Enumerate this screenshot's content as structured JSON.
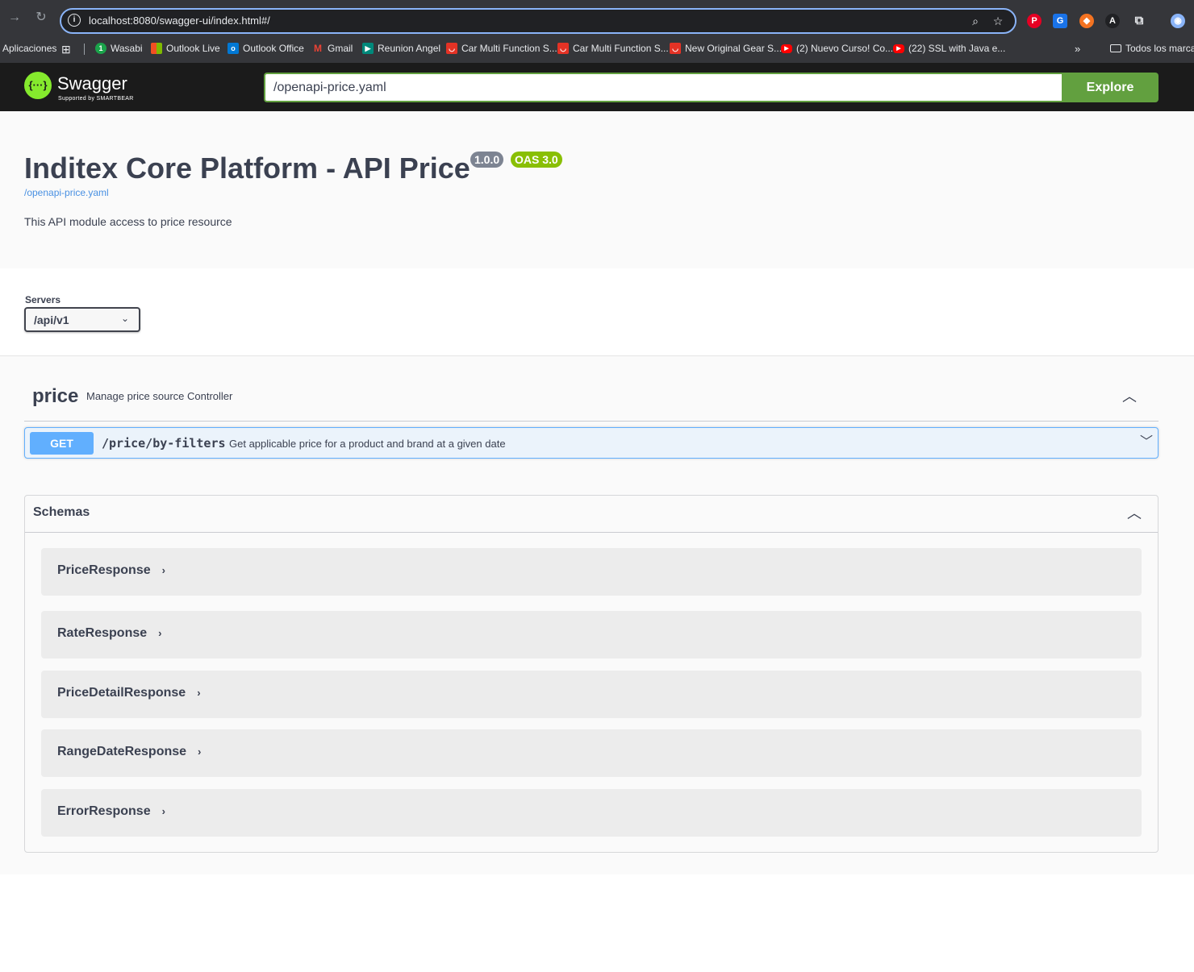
{
  "browser": {
    "url": "localhost:8080/swagger-ui/index.html#/",
    "bookmarks": [
      {
        "label": "Aplicaciones",
        "icon": "apps-icon"
      },
      {
        "label": "Wasabi",
        "icon": "wasabi-icon",
        "color": "#1aa34a"
      },
      {
        "label": "Outlook Live",
        "icon": "microsoft-icon",
        "color": "#f25022"
      },
      {
        "label": "Outlook Office",
        "icon": "outlook-icon",
        "color": "#0078d4"
      },
      {
        "label": "Gmail",
        "icon": "gmail-icon",
        "color": "#ea4335"
      },
      {
        "label": "Reunion Angel",
        "icon": "meet-icon",
        "color": "#00897b"
      },
      {
        "label": "Car Multi Function S...",
        "icon": "aliexpress-icon",
        "color": "#e43225"
      },
      {
        "label": "Car Multi Function S...",
        "icon": "aliexpress-icon",
        "color": "#e43225"
      },
      {
        "label": "New Original Gear S...",
        "icon": "aliexpress-icon",
        "color": "#e43225"
      },
      {
        "label": "(2) Nuevo Curso! Co...",
        "icon": "youtube-icon",
        "color": "#ff0000"
      },
      {
        "label": "(22) SSL with Java e...",
        "icon": "youtube-icon",
        "color": "#ff0000"
      }
    ],
    "all_bookmarks_label": "Todos los marcad"
  },
  "topbar": {
    "logo_text": "Swagger",
    "logo_sub": "Supported by SMARTBEAR",
    "url_value": "/openapi-price.yaml",
    "explore_label": "Explore"
  },
  "info": {
    "title": "Inditex Core Platform - API Price",
    "version": "1.0.0",
    "oas": "OAS 3.0",
    "spec_link": "/openapi-price.yaml",
    "description": "This API module access to price resource"
  },
  "servers": {
    "label": "Servers",
    "selected": "/api/v1"
  },
  "tag": {
    "name": "price",
    "description": "Manage price source Controller",
    "operations": [
      {
        "method": "GET",
        "path": "/price/by-filters",
        "summary": "Get applicable price for a product and brand at a given date"
      }
    ]
  },
  "schemas": {
    "title": "Schemas",
    "models": [
      "PriceResponse",
      "RateResponse",
      "PriceDetailResponse",
      "RangeDateResponse",
      "ErrorResponse"
    ]
  },
  "colors": {
    "get": "#61affe",
    "explore": "#62a03f",
    "version_badge": "#7d8492",
    "oas_badge": "#89bf04"
  }
}
